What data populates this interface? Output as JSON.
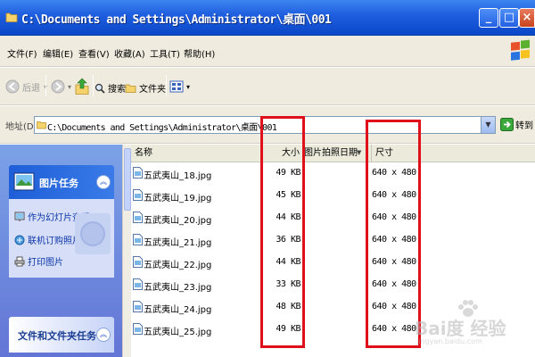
{
  "window": {
    "title": "C:\\Documents and Settings\\Administrator\\桌面\\001",
    "controls": [
      "_",
      "□",
      "×"
    ]
  },
  "menu": {
    "items": [
      "文件(F)",
      "编辑(E)",
      "查看(V)",
      "收藏(A)",
      "工具(T)",
      "帮助(H)"
    ]
  },
  "toolbar": {
    "back_label": "后退",
    "search_label": "搜索",
    "folders_label": "文件夹"
  },
  "address": {
    "label": "地址(D)",
    "value": "C:\\Documents and Settings\\Administrator\\桌面\\001",
    "go_label": "转到"
  },
  "taskpane": {
    "picture_tasks_title": "图片任务",
    "links": [
      "作为幻灯片查看",
      "联机订购照片",
      "打印图片"
    ],
    "file_tasks_title": "文件和文件夹任务"
  },
  "columns": {
    "name": "名称",
    "size": "大小",
    "date": "图片拍照日期",
    "dimensions": "尺寸"
  },
  "files": [
    {
      "name": "五武夷山_18.jpg",
      "size": "49 KB",
      "dimensions": "640 x 480"
    },
    {
      "name": "五武夷山_19.jpg",
      "size": "45 KB",
      "dimensions": "640 x 480"
    },
    {
      "name": "五武夷山_20.jpg",
      "size": "44 KB",
      "dimensions": "640 x 480"
    },
    {
      "name": "五武夷山_21.jpg",
      "size": "36 KB",
      "dimensions": "640 x 480"
    },
    {
      "name": "五武夷山_22.jpg",
      "size": "44 KB",
      "dimensions": "640 x 480"
    },
    {
      "name": "五武夷山_23.jpg",
      "size": "33 KB",
      "dimensions": "640 x 480"
    },
    {
      "name": "五武夷山_24.jpg",
      "size": "48 KB",
      "dimensions": "640 x 480"
    },
    {
      "name": "五武夷山_25.jpg",
      "size": "49 KB",
      "dimensions": "640 x 480"
    }
  ],
  "watermark": {
    "text": "Bai度 经验",
    "sub": "jingyan.baidu.com"
  },
  "colors": {
    "titlebar": "#1f5fe0",
    "highlight": "#e0101a",
    "taskpane": "#6f8fe0"
  }
}
